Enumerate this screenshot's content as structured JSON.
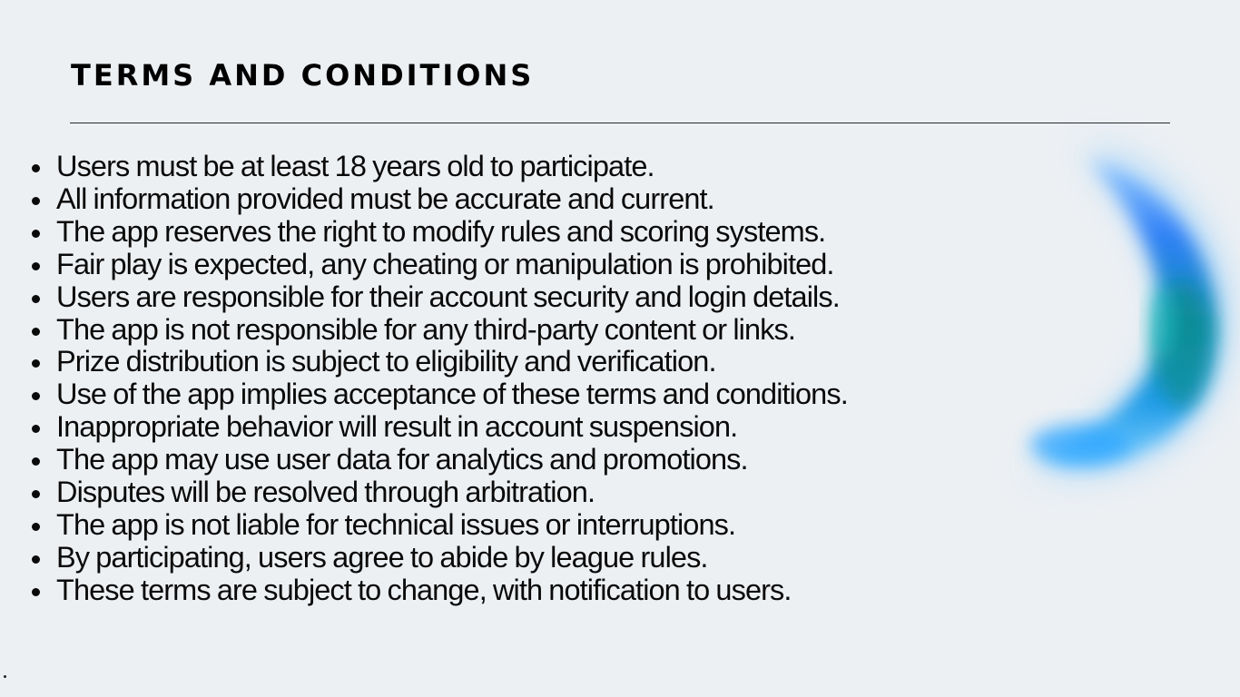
{
  "page": {
    "title": "TERMS AND CONDITIONS"
  },
  "terms": [
    "Users must be at least 18 years old to participate.",
    "All information provided must be accurate and current.",
    "The app reserves the right to modify rules and scoring systems.",
    "Fair play is expected, any cheating or manipulation is prohibited.",
    "Users are responsible for their account security and login details.",
    "The app is not responsible for any third-party content or links.",
    "Prize distribution is subject to eligibility and verification.",
    "Use of the app implies acceptance of these terms and conditions.",
    "Inappropriate behavior will result in account suspension.",
    "The app may use user data for analytics and promotions.",
    "Disputes will be resolved through arbitration.",
    "The app is not liable for technical issues or interruptions.",
    "By participating, users agree to abide by league rules.",
    "These terms are subject to change, with notification to users."
  ],
  "colors": {
    "background": "#edf0f3",
    "text": "#0a0a0a",
    "accent_blue": "#1e90ff",
    "accent_teal": "#14b8a6"
  }
}
